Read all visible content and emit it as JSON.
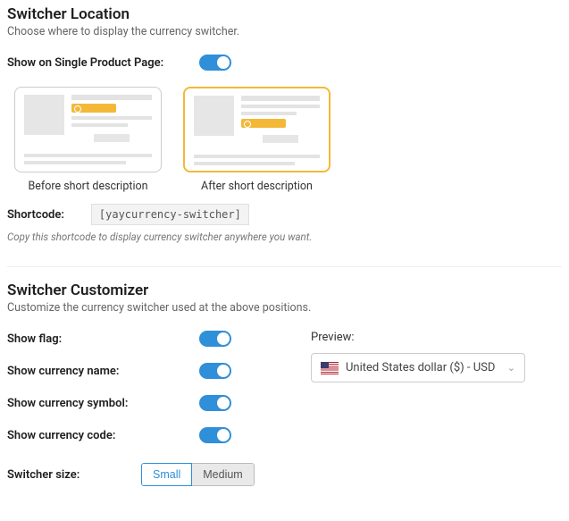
{
  "location": {
    "title": "Switcher Location",
    "desc": "Choose where to display the currency switcher.",
    "show_on_spp": "Show on Single Product Page:",
    "before_label": "Before short description",
    "after_label": "After short description",
    "shortcode_label": "Shortcode:",
    "shortcode": "[yaycurrency-switcher]",
    "shortcode_help": "Copy this shortcode to display currency switcher anywhere you want."
  },
  "customizer": {
    "title": "Switcher Customizer",
    "desc": "Customize the currency switcher used at the above positions.",
    "show_flag": "Show flag:",
    "show_name": "Show currency name:",
    "show_symbol": "Show currency symbol:",
    "show_code": "Show currency code:",
    "size_label": "Switcher size:",
    "size_small": "Small",
    "size_medium": "Medium",
    "preview_label": "Preview:",
    "preview_value": "United States dollar ($) - USD"
  }
}
